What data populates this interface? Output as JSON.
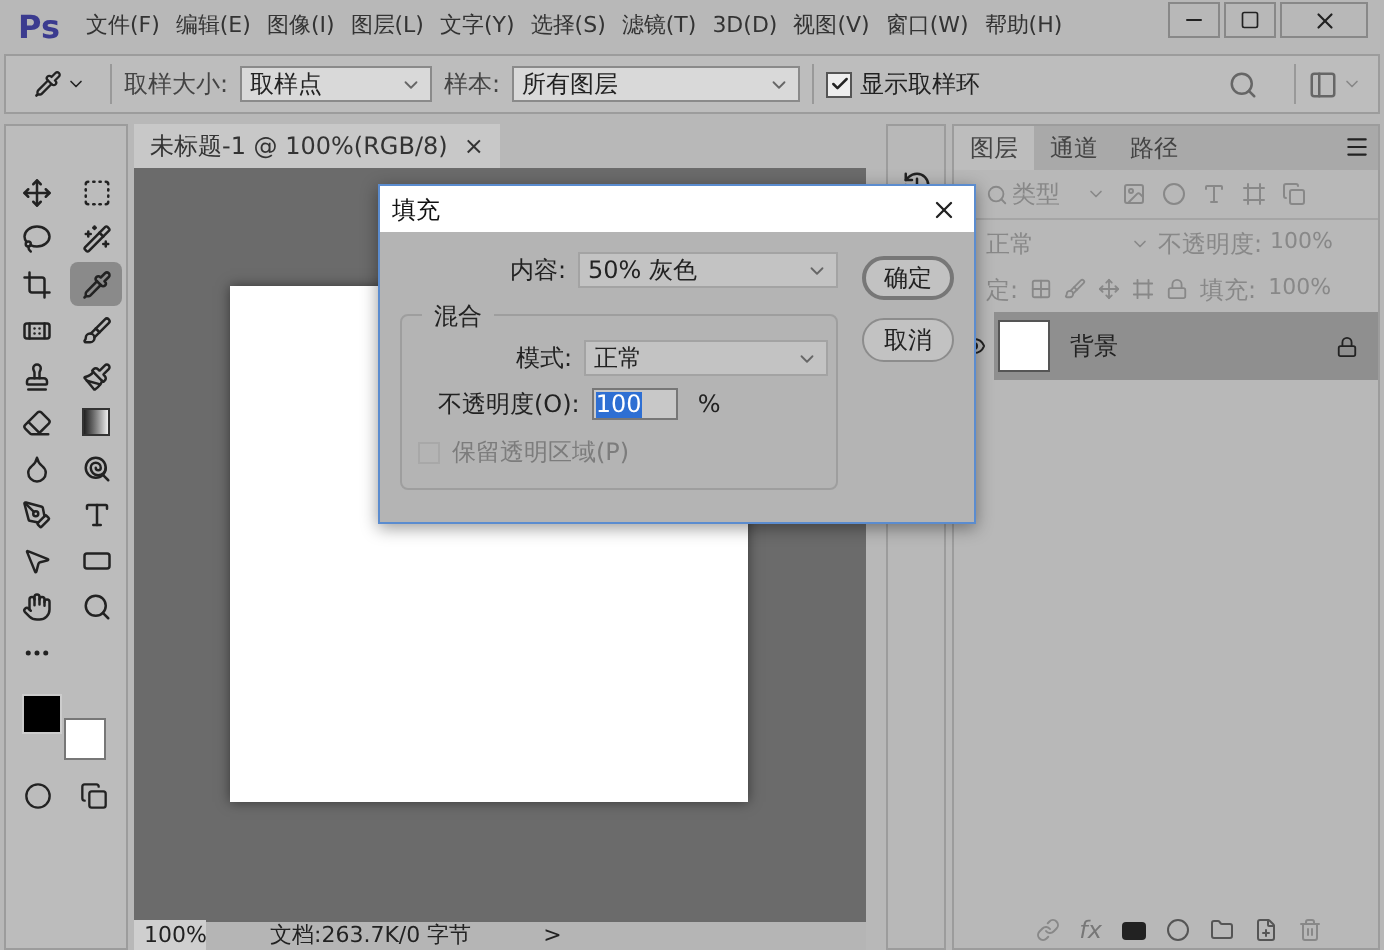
{
  "app": {
    "logo": "Ps"
  },
  "menu": [
    "文件(F)",
    "编辑(E)",
    "图像(I)",
    "图层(L)",
    "文字(Y)",
    "选择(S)",
    "滤镜(T)",
    "3D(D)",
    "视图(V)",
    "窗口(W)",
    "帮助(H)"
  ],
  "options_bar": {
    "sample_size_label": "取样大小:",
    "sample_size": "取样点",
    "sample_label": "样本:",
    "sample": "所有图层",
    "show_ring": {
      "label": "显示取样环",
      "checked": true
    }
  },
  "tools": [
    {
      "kind": "move",
      "selected": false
    },
    {
      "kind": "marquee",
      "selected": false
    },
    {
      "kind": "lasso",
      "selected": false
    },
    {
      "kind": "wand",
      "selected": false
    },
    {
      "kind": "crop",
      "selected": false
    },
    {
      "kind": "eyedropper",
      "selected": true
    },
    {
      "kind": "healing",
      "selected": false
    },
    {
      "kind": "brush",
      "selected": false
    },
    {
      "kind": "stamp",
      "selected": false
    },
    {
      "kind": "history-brush",
      "selected": false
    },
    {
      "kind": "eraser",
      "selected": false
    },
    {
      "kind": "gradient",
      "selected": false
    },
    {
      "kind": "blur",
      "selected": false
    },
    {
      "kind": "dodge",
      "selected": false
    },
    {
      "kind": "pen",
      "selected": false
    },
    {
      "kind": "type",
      "selected": false
    },
    {
      "kind": "path-select",
      "selected": false
    },
    {
      "kind": "shape",
      "selected": false
    },
    {
      "kind": "hand",
      "selected": false
    },
    {
      "kind": "zoom",
      "selected": false
    },
    {
      "kind": "more",
      "selected": false
    }
  ],
  "swatches": [
    {
      "color": "#000000"
    },
    {
      "color": "#ffffff"
    }
  ],
  "document": {
    "tab": "未标题-1 @ 100%(RGB/8)",
    "close": "×"
  },
  "status_bar": {
    "zoom": "100%",
    "info": "文档:263.7K/0 字节",
    "arrow": ">"
  },
  "layers_panel": {
    "tabs": [
      {
        "label": "图层",
        "selected": true
      },
      {
        "label": "通道",
        "selected": false
      },
      {
        "label": "路径",
        "selected": false
      }
    ],
    "filter": "类型",
    "blend_mode": "正常",
    "opacity_label": "不透明度:",
    "opacity": "100%",
    "lock_label": "定:",
    "fill_label": "填充:",
    "fill": "100%",
    "layers": [
      {
        "name": "背景",
        "selected": true,
        "visible": true,
        "locked": true
      }
    ],
    "fx": "fx"
  },
  "dialog": {
    "title": "填充",
    "content_label": "内容:",
    "content": "50% 灰色",
    "group": "混合",
    "mode_label": "模式:",
    "mode": "正常",
    "opacity_label": "不透明度(O):",
    "opacity": "100",
    "percent": "%",
    "preserve": {
      "label": "保留透明区域(P)",
      "checked": false,
      "disabled": true
    },
    "buttons": [
      {
        "label": "确定",
        "default": true
      },
      {
        "label": "取消",
        "default": false
      }
    ]
  }
}
